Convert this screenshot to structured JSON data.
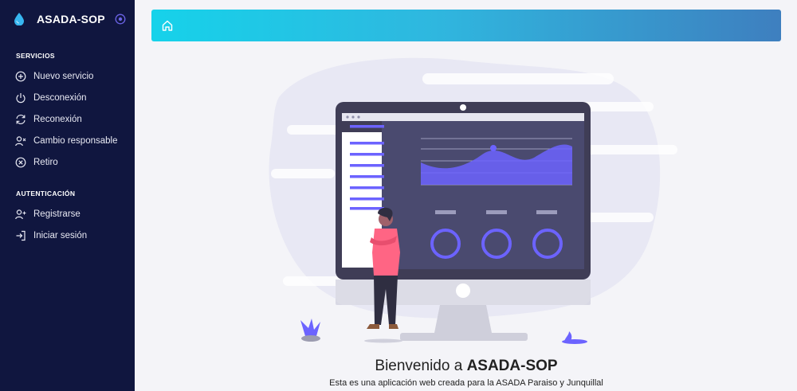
{
  "app": {
    "title": "ASADA-SOP"
  },
  "sidebar": {
    "sections": [
      {
        "title": "SERVICIOS",
        "items": [
          {
            "label": "Nuevo servicio",
            "icon": "plus-circle-icon"
          },
          {
            "label": "Desconexión",
            "icon": "power-icon"
          },
          {
            "label": "Reconexión",
            "icon": "refresh-icon"
          },
          {
            "label": "Cambio responsable",
            "icon": "user-x-icon"
          },
          {
            "label": "Retiro",
            "icon": "x-circle-icon"
          }
        ]
      },
      {
        "title": "AUTENTICACIÓN",
        "items": [
          {
            "label": "Registrarse",
            "icon": "user-plus-icon"
          },
          {
            "label": "Iniciar sesión",
            "icon": "log-in-icon"
          }
        ]
      }
    ]
  },
  "topbar": {
    "icon": "home-icon"
  },
  "welcome": {
    "prefix": "Bienvenido a ",
    "brand": "ASADA-SOP",
    "subtitle": "Esta es una aplicación web creada para la ASADA Paraiso y Junquillal"
  },
  "colors": {
    "sidebar": "#10163f",
    "accent": "#5b52d6",
    "topbar_start": "#16d2ea",
    "topbar_end": "#3e7fbf"
  }
}
